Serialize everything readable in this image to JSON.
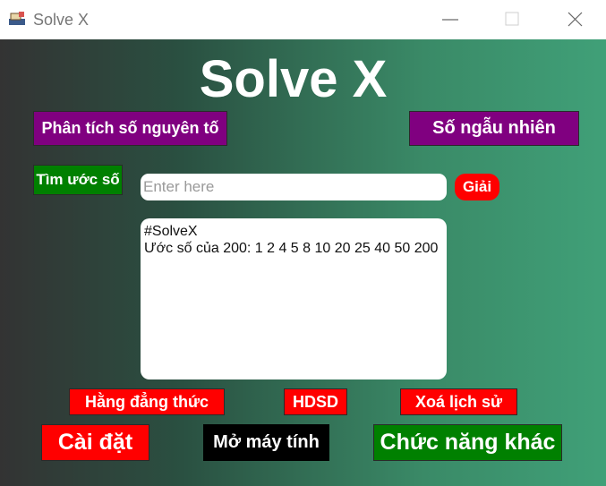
{
  "window": {
    "title": "Solve X",
    "icon": "app-icon",
    "controls": [
      "minimize-icon",
      "maximize-icon",
      "close-icon"
    ]
  },
  "app": {
    "heading": "Solve X"
  },
  "buttons": {
    "prime_factorization": "Phân tích số nguyên tố",
    "random_number": "Số ngẫu nhiên",
    "find_divisors": "Tìm ước số",
    "solve": "Giải",
    "identities": "Hằng đẳng thức",
    "guide": "HDSD",
    "clear_history": "Xoá lịch sử",
    "settings": "Cài đặt",
    "open_calculator": "Mở máy tính",
    "other_functions": "Chức năng khác"
  },
  "input": {
    "placeholder": "Enter here"
  },
  "output": {
    "lines": [
      "#SolveX",
      "Ước số của 200: 1 2 4 5 8 10 20 25 40 50 200"
    ]
  },
  "colors": {
    "purple_button": "#800080",
    "green_button": "#008000",
    "red_button": "#ff0000",
    "black_button": "#000000",
    "background_left": "#333333",
    "background_right": "#40a078"
  }
}
